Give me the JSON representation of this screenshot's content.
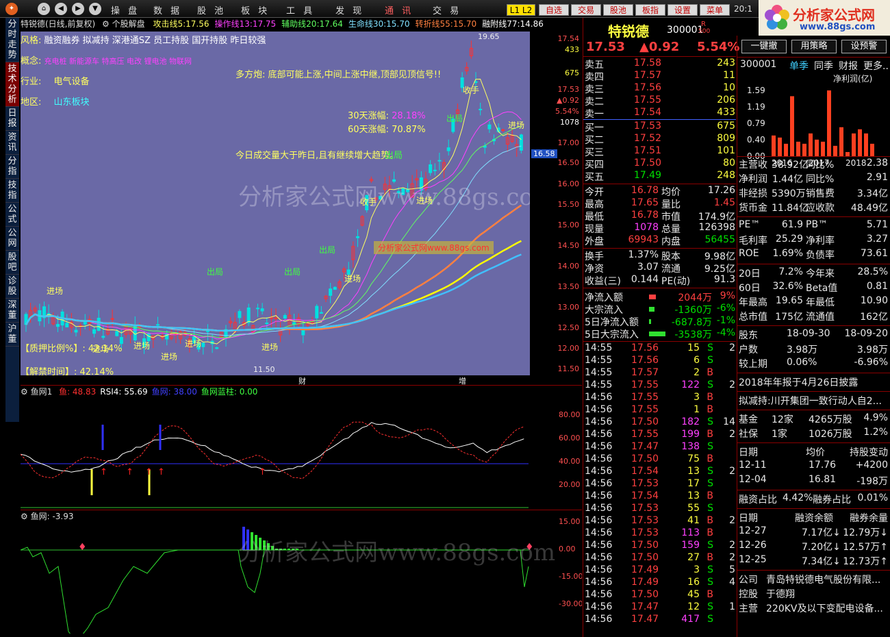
{
  "toolbar": {
    "menu": [
      "操 盘",
      "数 据",
      "股 池",
      "板 块",
      "工 具",
      "发 现",
      "通 讯",
      "交 易"
    ],
    "right_buttons": [
      "L1 L2",
      "自选",
      "交易",
      "股池",
      "板指",
      "设置",
      "菜单"
    ],
    "clock": "20:1"
  },
  "logo": {
    "text": "分析家公式网",
    "url": "www.88gs.com"
  },
  "sidebar": {
    "tabs": [
      "分时走势",
      "技术分析",
      "日报",
      "资讯",
      "分指",
      "技指",
      "公式",
      "公网",
      "股吧",
      "诊股",
      "深董",
      "沪董"
    ],
    "active": 1
  },
  "chart": {
    "title": "特锐德(日线,前复权)",
    "template": "个股解盘",
    "indicators": [
      {
        "label": "攻击线5:",
        "value": "17.56",
        "color": "#ffff60"
      },
      {
        "label": "操作线13:",
        "value": "17.75",
        "color": "#ff40ff"
      },
      {
        "label": "辅助线20:",
        "value": "17.64",
        "color": "#60ff60"
      },
      {
        "label": "生命线30:",
        "value": "15.70",
        "color": "#80e0ff"
      },
      {
        "label": "转折线55:",
        "value": "15.70",
        "color": "#ff8040"
      },
      {
        "label": "融附线77:",
        "value": "14.86",
        "color": "#ffffff"
      }
    ],
    "info": {
      "fengge_label": "风格:",
      "fengge": "融资融券 拟减持 深港通SZ 员工持股 国开持股 昨日较强",
      "gainian_label": "概念:",
      "gainian": "充电桩 新能源车 特高压 电改 锂电池 物联网",
      "hangye_label": "行业:",
      "hangye": "电气设备",
      "diqu_label": "地区:",
      "diqu": "山东板块",
      "duokong": "多方炮: 底部可能上涨,中间上涨中继,顶部见顶信号!!",
      "zhangfu30_label": "30天涨幅:",
      "zhangfu30": "28.18%",
      "zhangfu60_label": "60天涨幅:",
      "zhangfu60": "70.87%",
      "vol_note": "今日成交量大于昨日,且有继续增大趋势。",
      "zhiya": "【质押比例%】: 42.14%",
      "jiejin": "【解禁时间】: 42.14%",
      "chuju": "出局"
    },
    "watermark": "分析家公式网www.88gs.com",
    "watermark_small": "分析家公式网www.88gs.com",
    "labels": [
      {
        "t": "进场",
        "x": 38,
        "y": 370
      },
      {
        "t": "进场",
        "x": 105,
        "y": 455
      },
      {
        "t": "进场",
        "x": 165,
        "y": 450
      },
      {
        "t": "进场",
        "x": 205,
        "y": 466
      },
      {
        "t": "进场",
        "x": 240,
        "y": 447
      },
      {
        "t": "出局",
        "x": 272,
        "y": 342
      },
      {
        "t": "出局",
        "x": 385,
        "y": 342
      },
      {
        "t": "进场",
        "x": 352,
        "y": 452
      },
      {
        "t": "出局",
        "x": 436,
        "y": 310
      },
      {
        "t": "进场",
        "x": 473,
        "y": 352
      },
      {
        "t": "收手",
        "x": 496,
        "y": 240
      },
      {
        "t": "进场",
        "x": 578,
        "y": 238
      },
      {
        "t": "出局",
        "x": 622,
        "y": 118
      },
      {
        "t": "收手",
        "x": 646,
        "y": 77
      },
      {
        "t": "进场",
        "x": 712,
        "y": 128
      }
    ],
    "price_high": "19.65",
    "price_low": "11.50",
    "yticks": [
      "17.54",
      "433",
      "675",
      "17.53",
      "▲0.92",
      "5.54%",
      "1078",
      "17.00",
      "16.58",
      "16.50",
      "16.00",
      "15.50",
      "15.00",
      "14.50",
      "14.00",
      "13.50",
      "13.00",
      "12.50",
      "12.00",
      "11.50"
    ],
    "markers": [
      "财",
      "增"
    ]
  },
  "sub1": {
    "name": "鱼网1",
    "labels": [
      {
        "t": "鱼: 48.83",
        "c": "#ff3030"
      },
      {
        "t": "RSI4: 55.69",
        "c": "#ffffff"
      },
      {
        "t": "鱼网: 38.00",
        "c": "#4040ff"
      },
      {
        "t": "鱼网蓝柱: 0.00",
        "c": "#40ff40"
      }
    ],
    "yticks": [
      "80.00",
      "60.00",
      "40.00",
      "20.00"
    ]
  },
  "sub2": {
    "name": "鱼网",
    "value": ": -3.93",
    "yticks": [
      "15.00",
      "0.00",
      "-15.00",
      "-30.00"
    ]
  },
  "quote": {
    "name": "特锐德",
    "code": "300001",
    "flag": "R",
    "flag2": "500",
    "price": "17.53",
    "change": "▲0.92",
    "pct": "5.54%",
    "asks": [
      [
        "卖五",
        "17.58",
        "243"
      ],
      [
        "卖四",
        "17.57",
        "11"
      ],
      [
        "卖三",
        "17.56",
        "10"
      ],
      [
        "卖二",
        "17.55",
        "206"
      ],
      [
        "卖一",
        "17.54",
        "433"
      ]
    ],
    "bids": [
      [
        "买一",
        "17.53",
        "675"
      ],
      [
        "买二",
        "17.52",
        "809"
      ],
      [
        "买三",
        "17.51",
        "101"
      ],
      [
        "买四",
        "17.50",
        "80"
      ],
      [
        "买五",
        "17.49",
        "248"
      ]
    ],
    "stats": [
      [
        "今开",
        "16.78",
        "均价",
        "17.26"
      ],
      [
        "最高",
        "17.65",
        "量比",
        "1.45"
      ],
      [
        "最低",
        "16.78",
        "市值",
        "174.9亿"
      ],
      [
        "现量",
        "1078",
        "总量",
        "126398"
      ],
      [
        "外盘",
        "69943",
        "内盘",
        "56455"
      ]
    ],
    "stats2": [
      [
        "换手",
        "1.37%",
        "股本",
        "9.98亿"
      ],
      [
        "净资",
        "3.07",
        "流通",
        "9.25亿"
      ],
      [
        "收益(三)",
        "0.144",
        "PE(动)",
        "91.3"
      ]
    ],
    "flows": [
      [
        "净流入额",
        "2044万",
        "9%"
      ],
      [
        "大宗流入",
        "-1360万",
        "-6%"
      ],
      [
        "5日净流入额",
        "-687.8万",
        "-1%"
      ],
      [
        "5日大宗流入",
        "-3538万",
        "-4%"
      ]
    ],
    "ticks": [
      [
        "14:55",
        "17.56",
        "15",
        "S"
      ],
      [
        "14:55",
        "17.56",
        "6",
        "S"
      ],
      [
        "14:55",
        "17.57",
        "2",
        "B"
      ],
      [
        "14:55",
        "17.55",
        "122",
        "S"
      ],
      [
        "14:56",
        "17.55",
        "3",
        "B"
      ],
      [
        "14:56",
        "17.55",
        "1",
        "B"
      ],
      [
        "14:56",
        "17.50",
        "182",
        "S"
      ],
      [
        "14:56",
        "17.55",
        "199",
        "B"
      ],
      [
        "14:56",
        "17.47",
        "138",
        "S"
      ],
      [
        "14:56",
        "17.50",
        "75",
        "B"
      ],
      [
        "14:56",
        "17.54",
        "13",
        "S"
      ],
      [
        "14:56",
        "17.53",
        "17",
        "S"
      ],
      [
        "14:56",
        "17.54",
        "13",
        "B"
      ],
      [
        "14:56",
        "17.53",
        "55",
        "S"
      ],
      [
        "14:56",
        "17.53",
        "41",
        "B"
      ],
      [
        "14:56",
        "17.53",
        "113",
        "B"
      ],
      [
        "14:56",
        "17.50",
        "159",
        "S"
      ],
      [
        "14:56",
        "17.50",
        "27",
        "B"
      ],
      [
        "14:56",
        "17.49",
        "3",
        "S"
      ],
      [
        "14:56",
        "17.49",
        "16",
        "S"
      ],
      [
        "14:56",
        "17.50",
        "45",
        "B"
      ],
      [
        "14:56",
        "17.47",
        "12",
        "S"
      ],
      [
        "14:56",
        "17.47",
        "417",
        "S"
      ]
    ],
    "tick_extra": [
      "2",
      "",
      "",
      "2",
      "",
      "",
      "14",
      "2",
      "",
      "",
      "2",
      "",
      "",
      "",
      "2",
      "",
      "2",
      "2",
      "5",
      "4",
      "",
      "1",
      ""
    ]
  },
  "f10": {
    "buttons": [
      "一键撤",
      "用策略",
      "设预警"
    ],
    "code": "300001",
    "tabs": [
      "单季",
      "同季",
      "财报",
      "更多.."
    ],
    "metric": "净利润(亿)",
    "bar_y": [
      "1.59",
      "1.19",
      "0.79",
      "0.40",
      "0.00"
    ],
    "bar_years": [
      "2016",
      "2017",
      "2018"
    ],
    "bars": [
      0.5,
      0.45,
      0.3,
      1.45,
      0.35,
      0.3,
      0.55,
      0.4,
      0.35,
      1.59,
      0.25,
      0.7,
      0.1,
      0.55,
      0.65,
      0.55,
      0.3
    ],
    "rows1": [
      [
        "主营收",
        "38.92亿",
        "同比%",
        "2.38"
      ],
      [
        "净利润",
        "1.44亿",
        "同比%",
        "2.91"
      ],
      [
        "非经损",
        "5390万",
        "销售费",
        "3.34亿"
      ],
      [
        "货币金",
        "11.84亿",
        "应收款",
        "48.49亿"
      ]
    ],
    "rows2": [
      [
        "PE™",
        "61.9",
        "PB™",
        "5.71"
      ],
      [
        "毛利率",
        "25.29",
        "净利率",
        "3.27"
      ],
      [
        "ROE",
        "1.69%",
        "负债率",
        "73.61"
      ]
    ],
    "rows3": [
      [
        "20日",
        "7.2%",
        "今年来",
        "28.5%"
      ],
      [
        "60日",
        "32.6%",
        "Beta值",
        "0.81"
      ],
      [
        "年最高",
        "19.65",
        "年最低",
        "10.90"
      ],
      [
        "总市值",
        "175亿",
        "流通值",
        "162亿"
      ]
    ],
    "holders": [
      [
        "股东",
        "18-09-30",
        "18-09-20"
      ],
      [
        "户数",
        "3.98万",
        "3.98万"
      ],
      [
        "较上期",
        "0.06%",
        "-6.96%"
      ]
    ],
    "report": "2018年年报于4月26日披露",
    "reduce": "拟减持:川开集团一致行动人自2...",
    "funds": [
      [
        "基金",
        "12家",
        "4265万股",
        "4.9%"
      ],
      [
        "社保",
        "1家",
        "1026万股",
        "1.2%"
      ]
    ],
    "trades_head": [
      "日期",
      "均价",
      "持股变动"
    ],
    "trades": [
      [
        "12-11",
        "17.76",
        "+4200"
      ],
      [
        "12-04",
        "16.81",
        "-198万"
      ]
    ],
    "margin": [
      "融资占比",
      "4.42%",
      "融券占比",
      "0.01%"
    ],
    "margin_head": [
      "日期",
      "融资余额",
      "融券余量"
    ],
    "margin_rows": [
      [
        "12-27",
        "7.17亿↓",
        "12.79万↓"
      ],
      [
        "12-26",
        "7.20亿↓",
        "12.57万↑"
      ],
      [
        "12-25",
        "7.34亿↓",
        "12.73万↑"
      ]
    ],
    "company": [
      [
        "公司",
        "青岛特锐德电气股份有限..."
      ],
      [
        "控股",
        "于德翔"
      ],
      [
        "主营",
        "220KV及以下变配电设备..."
      ]
    ]
  }
}
